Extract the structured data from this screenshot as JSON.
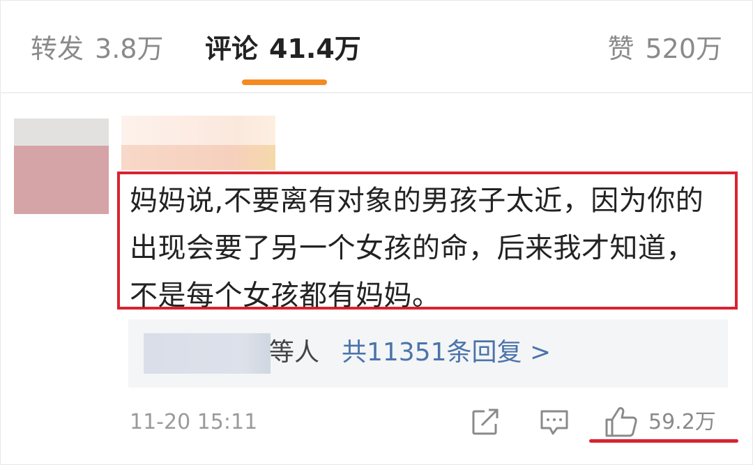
{
  "tabs": {
    "repost": {
      "label": "转发",
      "count": "3.8万"
    },
    "comments": {
      "label": "评论",
      "count": "41.4万"
    },
    "likes": {
      "label": "赞",
      "count": "520万"
    }
  },
  "comment": {
    "text": "妈妈说,不要离有对象的男孩子太近，因为你的出现会要了另一个女孩的命，后来我才知道，不是每个女孩都有妈妈。",
    "reply_by": "等人",
    "reply_link": "共11351条回复 >",
    "timestamp": "11-20 15:11",
    "like_count": "59.2万"
  },
  "colors": {
    "accent_tab": "#f58a1f",
    "highlight_red": "#d9232f",
    "link_blue": "#4a74aa"
  },
  "icons": [
    "share-icon",
    "comment-icon",
    "thumbs-up-icon"
  ]
}
